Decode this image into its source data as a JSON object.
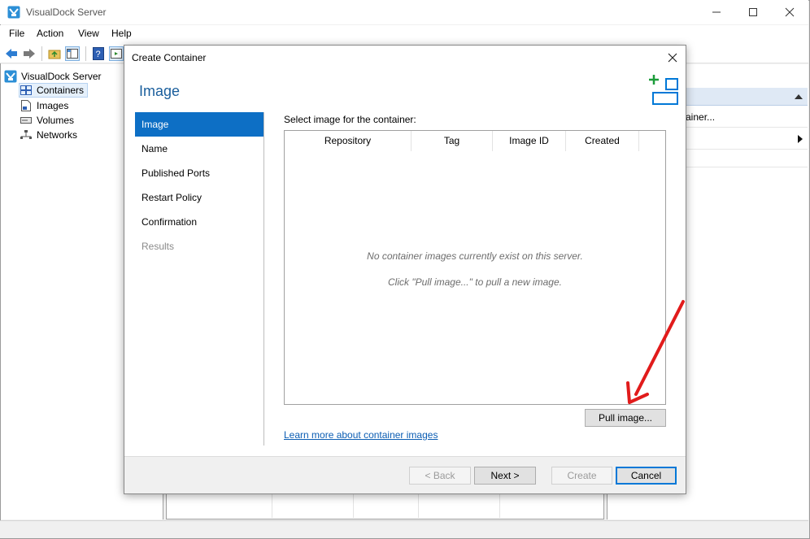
{
  "window": {
    "title": "VisualDock Server"
  },
  "menu": {
    "items": [
      "File",
      "Action",
      "View",
      "Help"
    ]
  },
  "tree": {
    "root": "VisualDock Server",
    "items": [
      {
        "label": "Containers",
        "icon": "containers-icon"
      },
      {
        "label": "Images",
        "icon": "images-icon"
      },
      {
        "label": "Volumes",
        "icon": "volumes-icon"
      },
      {
        "label": "Networks",
        "icon": "networks-icon"
      }
    ]
  },
  "actions_pane": {
    "partial_item": "ainer..."
  },
  "dialog": {
    "title": "Create Container",
    "heading": "Image",
    "nav": [
      {
        "label": "Image",
        "state": "active"
      },
      {
        "label": "Name",
        "state": "normal"
      },
      {
        "label": "Published Ports",
        "state": "normal"
      },
      {
        "label": "Restart Policy",
        "state": "normal"
      },
      {
        "label": "Confirmation",
        "state": "normal"
      },
      {
        "label": "Results",
        "state": "disabled"
      }
    ],
    "select_label": "Select image for the container:",
    "columns": [
      "Repository",
      "Tag",
      "Image ID",
      "Created"
    ],
    "empty_message_1": "No container images currently exist on this server.",
    "empty_message_2": "Click \"Pull image...\" to pull a new image.",
    "pull_button": "Pull image...",
    "learn_more": "Learn more about container images",
    "footer": {
      "back": "< Back",
      "next": "Next >",
      "create": "Create",
      "cancel": "Cancel"
    }
  },
  "colors": {
    "accent": "#0d6fc5",
    "heading": "#1a5e9c",
    "link": "#0b5db3",
    "annotation_arrow": "#e11b1b",
    "graphic_green": "#1c9c3a",
    "graphic_blue": "#0078d7"
  }
}
